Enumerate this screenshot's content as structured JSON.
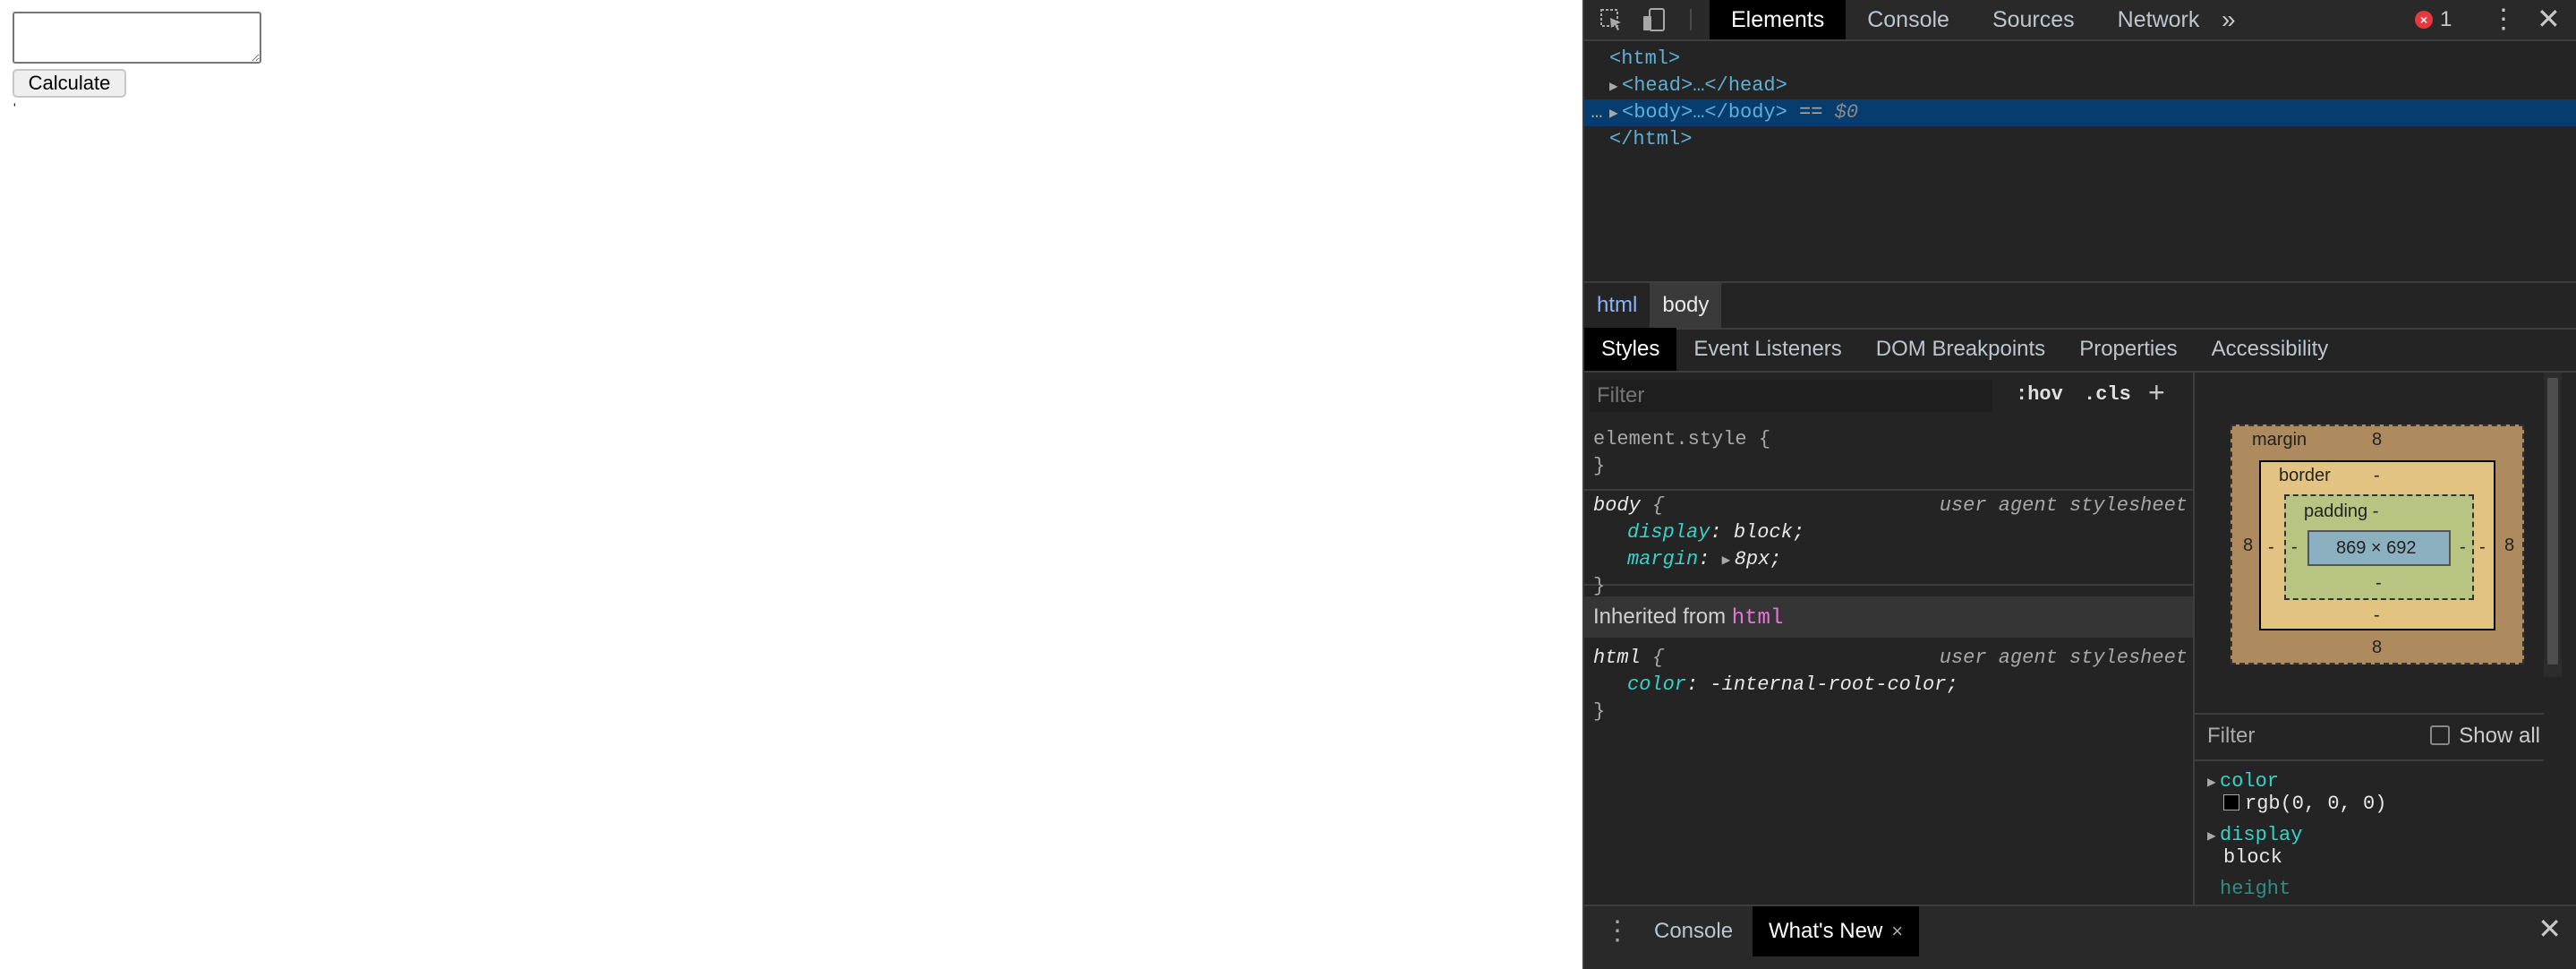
{
  "page": {
    "button_label": "Calculate",
    "result_text": "'"
  },
  "devtools": {
    "tabs": [
      "Elements",
      "Console",
      "Sources",
      "Network"
    ],
    "more_tabs": "»",
    "error_count": "1",
    "error_badge": "×",
    "dom": {
      "html_open": "<html>",
      "head": "<head>…</head>",
      "body": "<body>…</body>",
      "body_suffix": " == ",
      "body_var": "$0",
      "ellipsis": "…",
      "html_close": "</html>"
    },
    "breadcrumbs": [
      "html",
      "body"
    ],
    "subtabs": [
      "Styles",
      "Event Listeners",
      "DOM Breakpoints",
      "Properties",
      "Accessibility"
    ],
    "styles": {
      "filter_placeholder": "Filter",
      "hov": ":hov",
      "cls": ".cls",
      "plus": "+",
      "element_style": "element.style {",
      "close_brace": "}",
      "body_rule": {
        "selector": "body",
        "open": " {",
        "source": "user agent stylesheet",
        "props": [
          {
            "name": "display",
            "value": "block"
          },
          {
            "name": "margin",
            "value": "8px"
          }
        ]
      },
      "inherited_label": "Inherited from ",
      "inherited_tag": "html",
      "html_rule": {
        "selector": "html",
        "open": " {",
        "source": "user agent stylesheet",
        "props": [
          {
            "name": "color",
            "value": "-internal-root-color"
          }
        ]
      }
    },
    "box_model": {
      "margin_label": "margin",
      "margin_top": "8",
      "margin_bottom": "8",
      "margin_left": "8",
      "margin_right": "8",
      "border_label": "border",
      "border_top": "-",
      "border_bottom": "-",
      "border_left": "-",
      "border_right": "-",
      "padding_label": "padding -",
      "padding_bottom": "-",
      "padding_left": "-",
      "padding_right": "-",
      "content_size": "869 × 692"
    },
    "computed": {
      "filter_placeholder": "Filter",
      "show_all": "Show all",
      "props": [
        {
          "name": "color",
          "value": "rgb(0, 0, 0)"
        },
        {
          "name": "display",
          "value": "block"
        },
        {
          "name": "height",
          "value": ""
        }
      ]
    },
    "drawer": {
      "tabs": [
        "Console",
        "What's New"
      ],
      "close_tab": "×",
      "close": "✕"
    }
  }
}
